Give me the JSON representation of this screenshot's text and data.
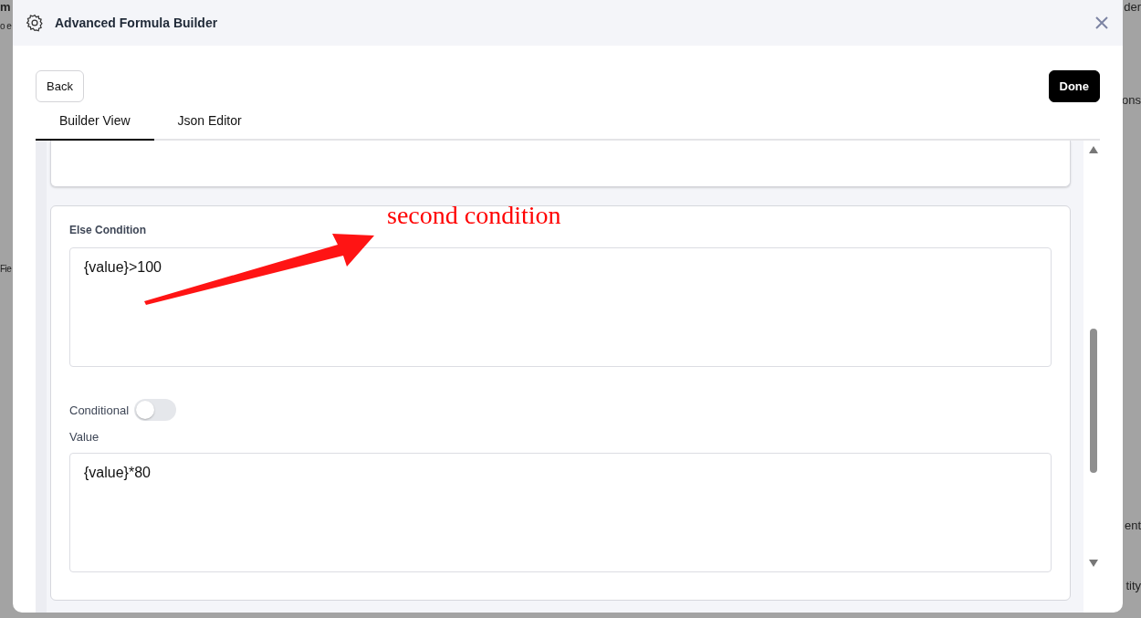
{
  "window": {
    "title": "Advanced Formula Builder"
  },
  "background": {
    "left": [
      "m",
      "o e",
      "Fie"
    ],
    "right": [
      "der",
      "ons",
      "ent",
      "tity"
    ]
  },
  "toolbar": {
    "back": "Back",
    "done": "Done"
  },
  "tabs": [
    {
      "label": "Builder View",
      "selected": true
    },
    {
      "label": "Json Editor",
      "selected": false
    }
  ],
  "else_condition": {
    "title": "Else Condition",
    "condition": "{value}>100",
    "conditional_label": "Conditional",
    "conditional_on": false,
    "value_label": "Value",
    "value": "{value}*80"
  },
  "annotation": {
    "text": "second condition"
  }
}
